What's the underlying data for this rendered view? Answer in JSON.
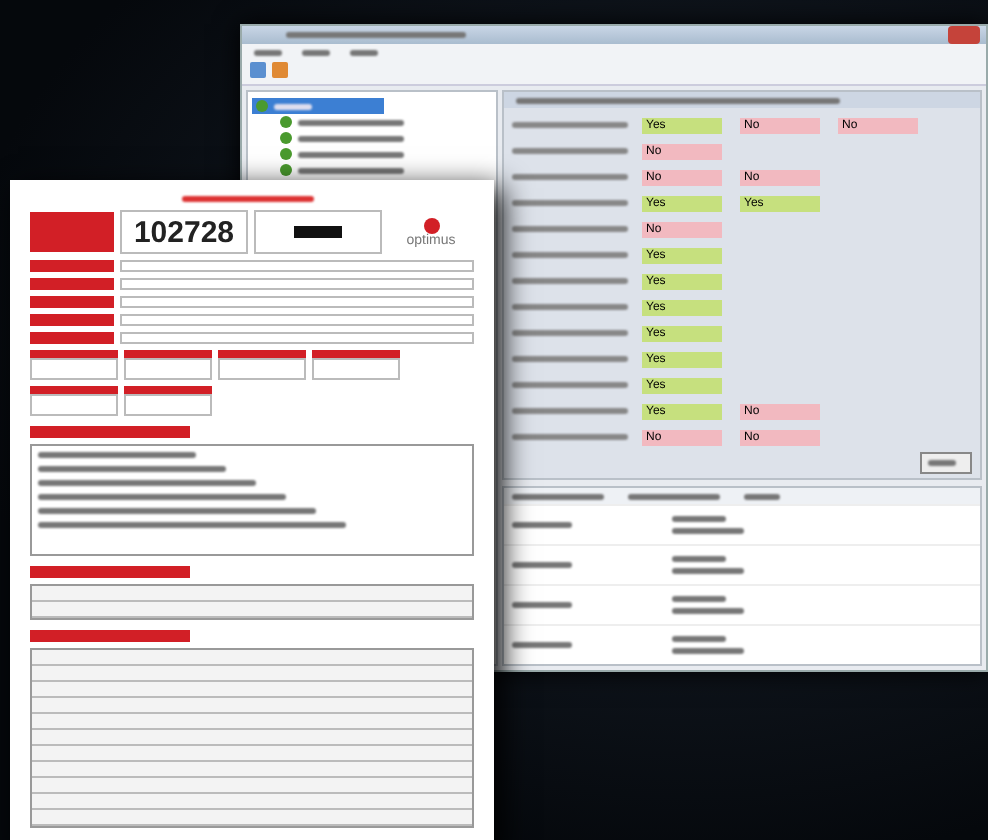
{
  "app_window": {
    "tree": [
      {
        "selected": true,
        "children": [
          {
            "selected": false
          },
          {
            "selected": false
          },
          {
            "selected": false
          },
          {
            "selected": false
          }
        ]
      }
    ],
    "fields": [
      {
        "values": [
          {
            "text": "Yes",
            "ok": true
          },
          {
            "text": "No",
            "ok": false
          },
          {
            "text": "No",
            "ok": false
          }
        ]
      },
      {
        "values": [
          {
            "text": "No",
            "ok": false
          }
        ]
      },
      {
        "values": [
          {
            "text": "No",
            "ok": false
          },
          {
            "text": "No",
            "ok": false
          }
        ]
      },
      {
        "values": [
          {
            "text": "Yes",
            "ok": true
          },
          {
            "text": "Yes",
            "ok": true
          }
        ]
      },
      {
        "values": [
          {
            "text": "No",
            "ok": false
          }
        ]
      },
      {
        "values": [
          {
            "text": "Yes",
            "ok": true
          }
        ]
      },
      {
        "values": [
          {
            "text": "Yes",
            "ok": true
          }
        ]
      },
      {
        "values": [
          {
            "text": "Yes",
            "ok": true
          }
        ]
      },
      {
        "values": [
          {
            "text": "Yes",
            "ok": true
          }
        ]
      },
      {
        "values": [
          {
            "text": "Yes",
            "ok": true
          }
        ]
      },
      {
        "values": [
          {
            "text": "Yes",
            "ok": true
          }
        ]
      },
      {
        "values": [
          {
            "text": "Yes",
            "ok": true
          },
          {
            "text": "No",
            "ok": false
          }
        ]
      },
      {
        "values": [
          {
            "text": "No",
            "ok": false
          },
          {
            "text": "No",
            "ok": false
          }
        ]
      }
    ]
  },
  "document": {
    "job_number": "102728",
    "logo": "optimus"
  }
}
